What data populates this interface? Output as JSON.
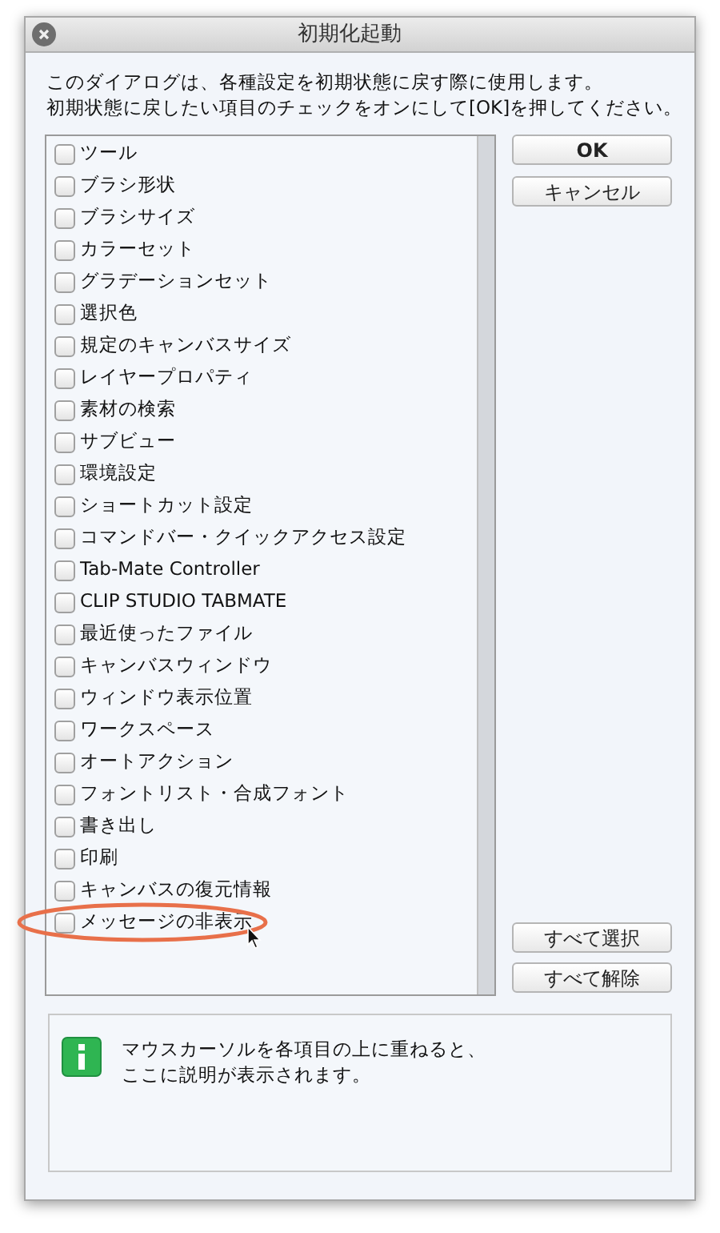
{
  "window": {
    "title": "初期化起動"
  },
  "instructions": [
    "このダイアログは、各種設定を初期状態に戻す際に使用します。",
    "初期状態に戻したい項目のチェックをオンにして[OK]を押してください。"
  ],
  "items": [
    {
      "label": "ツール",
      "checked": false
    },
    {
      "label": "ブラシ形状",
      "checked": false
    },
    {
      "label": "ブラシサイズ",
      "checked": false
    },
    {
      "label": "カラーセット",
      "checked": false
    },
    {
      "label": "グラデーションセット",
      "checked": false
    },
    {
      "label": "選択色",
      "checked": false
    },
    {
      "label": "規定のキャンバスサイズ",
      "checked": false
    },
    {
      "label": "レイヤープロパティ",
      "checked": false
    },
    {
      "label": "素材の検索",
      "checked": false
    },
    {
      "label": "サブビュー",
      "checked": false
    },
    {
      "label": "環境設定",
      "checked": false
    },
    {
      "label": "ショートカット設定",
      "checked": false
    },
    {
      "label": "コマンドバー・クイックアクセス設定",
      "checked": false
    },
    {
      "label": "Tab-Mate Controller",
      "checked": false
    },
    {
      "label": "CLIP STUDIO TABMATE",
      "checked": false
    },
    {
      "label": "最近使ったファイル",
      "checked": false
    },
    {
      "label": "キャンバスウィンドウ",
      "checked": false
    },
    {
      "label": "ウィンドウ表示位置",
      "checked": false
    },
    {
      "label": "ワークスペース",
      "checked": false
    },
    {
      "label": "オートアクション",
      "checked": false
    },
    {
      "label": "フォントリスト・合成フォント",
      "checked": false
    },
    {
      "label": "書き出し",
      "checked": false
    },
    {
      "label": "印刷",
      "checked": false
    },
    {
      "label": "キャンバスの復元情報",
      "checked": false
    },
    {
      "label": "メッセージの非表示",
      "checked": false,
      "highlighted": true
    }
  ],
  "buttons": {
    "ok": "OK",
    "cancel": "キャンセル",
    "select_all": "すべて選択",
    "clear_all": "すべて解除"
  },
  "info": [
    "マウスカーソルを各項目の上に重ねると、",
    "ここに説明が表示されます。"
  ]
}
